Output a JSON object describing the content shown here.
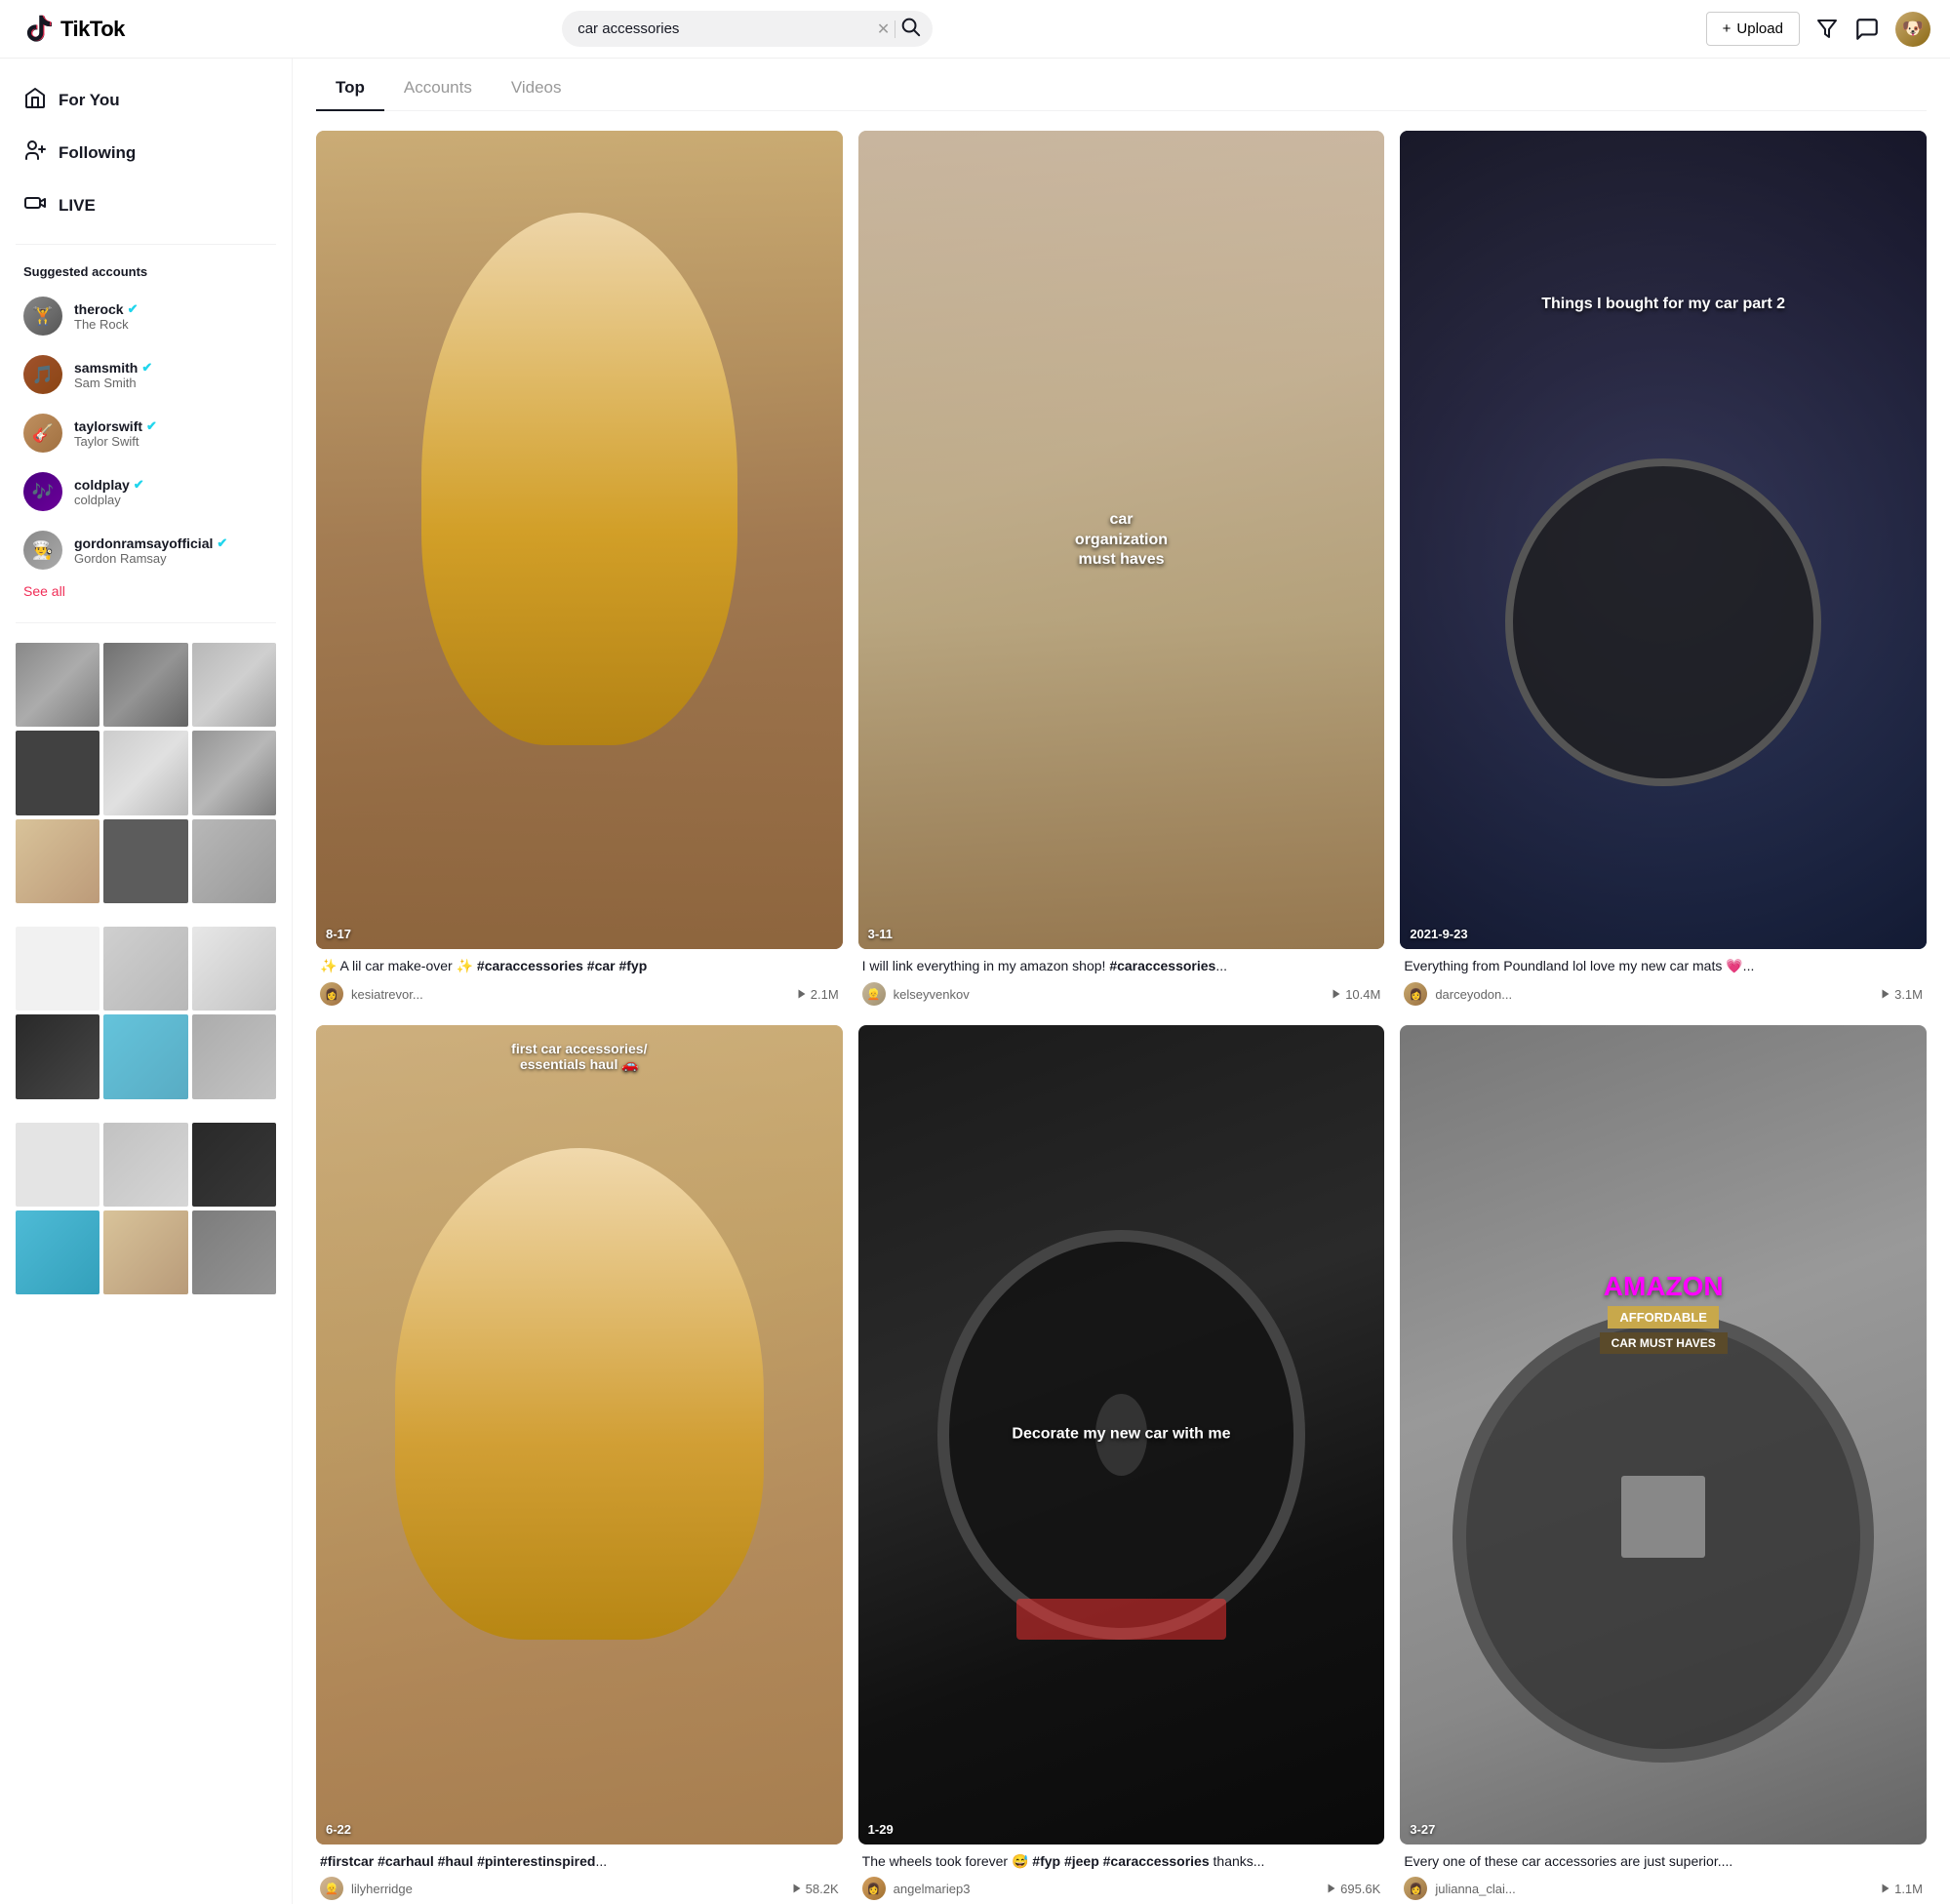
{
  "header": {
    "logo_text": "TikTok",
    "search_value": "car accessories",
    "upload_label": "Upload",
    "upload_icon": "+",
    "inbox_icon": "✉",
    "filter_icon": "▽"
  },
  "sidebar": {
    "nav_items": [
      {
        "id": "for-you",
        "label": "For You",
        "icon": "⌂"
      },
      {
        "id": "following",
        "label": "Following",
        "icon": "👤"
      },
      {
        "id": "live",
        "label": "LIVE",
        "icon": "📷"
      }
    ],
    "suggested_title": "Suggested accounts",
    "accounts": [
      {
        "id": "therock",
        "username": "therock",
        "display_name": "The Rock",
        "verified": true,
        "emoji": "🏋"
      },
      {
        "id": "samsmith",
        "username": "samsmith",
        "display_name": "Sam Smith",
        "verified": true,
        "emoji": "🎵"
      },
      {
        "id": "taylorswift",
        "username": "taylorswift",
        "display_name": "Taylor Swift",
        "verified": true,
        "emoji": "🎸"
      },
      {
        "id": "coldplay",
        "username": "coldplay",
        "display_name": "coldplay",
        "verified": true,
        "emoji": "🎶"
      },
      {
        "id": "gordonramsayofficial",
        "username": "gordonramsayofficial",
        "display_name": "Gordon Ramsay",
        "verified": true,
        "emoji": "👨‍🍳"
      }
    ],
    "see_all_label": "See all"
  },
  "search_tabs": [
    {
      "id": "top",
      "label": "Top",
      "active": true
    },
    {
      "id": "accounts",
      "label": "Accounts",
      "active": false
    },
    {
      "id": "videos",
      "label": "Videos",
      "active": false
    }
  ],
  "videos": [
    {
      "id": "v1",
      "date_badge": "8-17",
      "overlay_text": "",
      "overlay_top": "",
      "desc": "✨ A lil car make-over ✨ #caraccessories #car #fyp",
      "username": "kesiatrevor...",
      "views": "2.1M",
      "thumb_class": "thumb-1"
    },
    {
      "id": "v2",
      "date_badge": "3-11",
      "overlay_text": "car organization must haves",
      "overlay_top": "",
      "desc": "I will link everything in my amazon shop! #caraccessories...",
      "username": "kelseyvenkov",
      "views": "10.4M",
      "thumb_class": "thumb-2"
    },
    {
      "id": "v3",
      "date_badge": "2021-9-23",
      "overlay_text": "Things I bought for my car part 2",
      "overlay_top": "",
      "desc": "Everything from Poundland lol love my new car mats 💗...",
      "username": "darceyodon...",
      "views": "3.1M",
      "thumb_class": "thumb-3"
    },
    {
      "id": "v4",
      "date_badge": "6-22",
      "overlay_text": "",
      "overlay_top": "first car accessories/ essentials haul 🚗",
      "desc": "#firstcar #carhaul #haul #pinterestinspired...",
      "username": "lilyherridge",
      "views": "58.2K",
      "thumb_class": "thumb-4"
    },
    {
      "id": "v5",
      "date_badge": "1-29",
      "overlay_text": "Decorate my new car with me",
      "overlay_top": "",
      "desc": "The wheels took forever 😅 #fyp #jeep #caraccessories thanks...",
      "username": "angelmariep3",
      "views": "695.6K",
      "thumb_class": "thumb-5"
    },
    {
      "id": "v6",
      "date_badge": "3-27",
      "overlay_text": "",
      "overlay_top": "",
      "amazon": true,
      "desc": "Every one of these car accessories are just superior....",
      "username": "julianna_clai...",
      "views": "1.1M",
      "thumb_class": "thumb-6"
    }
  ],
  "amazon_labels": {
    "title": "AMAZON",
    "badge1": "AFFORDABLE",
    "badge2": "CAR MUST HAVES"
  }
}
